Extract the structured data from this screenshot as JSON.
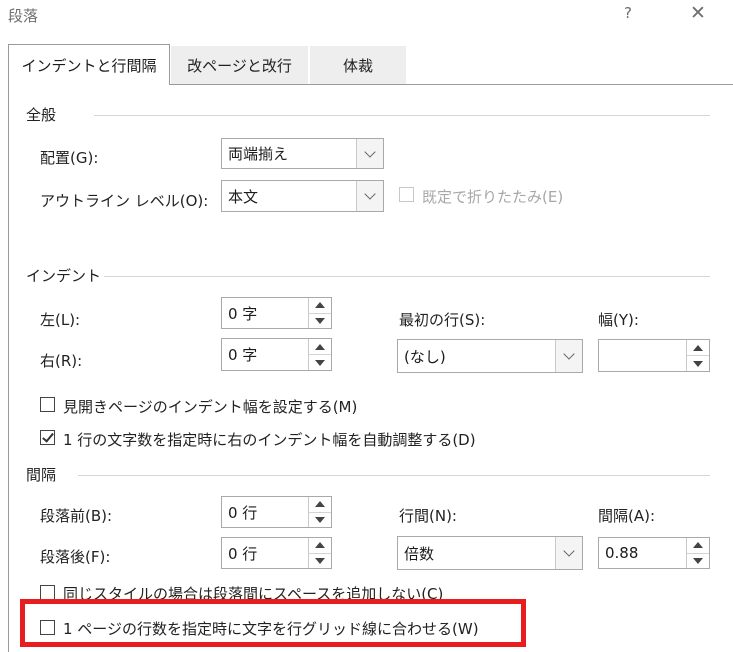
{
  "window": {
    "title": "段落",
    "help": "?",
    "close": "✕"
  },
  "tabs": [
    {
      "label": "インデントと行間隔",
      "active": true
    },
    {
      "label": "改ページと改行",
      "active": false
    },
    {
      "label": "体裁",
      "active": false
    }
  ],
  "general": {
    "header": "全般",
    "alignment": {
      "label": "配置(G):",
      "value": "両端揃え"
    },
    "outline": {
      "label": "アウトライン レベル(O):",
      "value": "本文"
    },
    "collapse": {
      "label": "既定で折りたたみ(E)",
      "checked": false,
      "enabled": false
    }
  },
  "indent": {
    "header": "インデント",
    "left": {
      "label": "左(L):",
      "value": "0 字"
    },
    "right": {
      "label": "右(R):",
      "value": "0 字"
    },
    "special": {
      "label": "最初の行(S):",
      "value": "(なし)"
    },
    "by": {
      "label": "幅(Y):",
      "value": ""
    },
    "mirror": {
      "label": "見開きページのインデント幅を設定する(M)",
      "checked": false
    },
    "auto_adjust": {
      "label": "1 行の文字数を指定時に右のインデント幅を自動調整する(D)",
      "checked": true
    }
  },
  "spacing": {
    "header": "間隔",
    "before": {
      "label": "段落前(B):",
      "value": "0 行"
    },
    "after": {
      "label": "段落後(F):",
      "value": "0 行"
    },
    "line_spacing": {
      "label": "行間(N):",
      "value": "倍数"
    },
    "at": {
      "label": "間隔(A):",
      "value": "0.88"
    },
    "dont_add_space": {
      "label": "同じスタイルの場合は段落間にスペースを追加しない(C)",
      "checked": false
    },
    "snap_to_grid": {
      "label": "1 ページの行数を指定時に文字を行グリッド線に合わせる(W)",
      "checked": false
    }
  },
  "colors": {
    "highlight": "#e81e1e"
  }
}
